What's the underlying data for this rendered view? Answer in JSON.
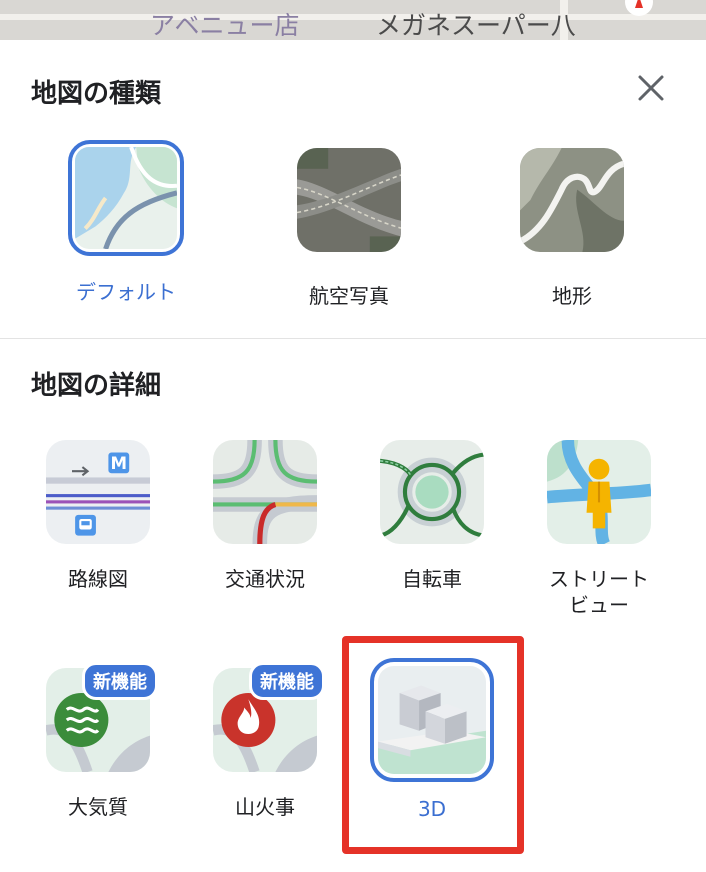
{
  "map": {
    "label_1": "アベニュー店",
    "label_2": "メガネスーパー八"
  },
  "map_types": {
    "title": "地図の種類",
    "close_icon": "close-icon",
    "items": [
      {
        "label": "デフォルト",
        "selected": true
      },
      {
        "label": "航空写真",
        "selected": false
      },
      {
        "label": "地形",
        "selected": false
      }
    ]
  },
  "map_details": {
    "title": "地図の詳細",
    "new_badge": "新機能",
    "items": [
      {
        "label": "路線図",
        "icon": "transit-map-icon"
      },
      {
        "label": "交通状況",
        "icon": "traffic-icon"
      },
      {
        "label": "自転車",
        "icon": "bicycle-map-icon"
      },
      {
        "label": "ストリート\nビュー",
        "label_line1": "ストリート",
        "label_line2": "ビュー",
        "icon": "street-view-icon"
      },
      {
        "label": "大気質",
        "icon": "air-quality-icon",
        "new": true
      },
      {
        "label": "山火事",
        "icon": "wildfire-icon",
        "new": true
      },
      {
        "label": "3D",
        "icon": "3d-buildings-icon",
        "selected": true
      }
    ]
  },
  "colors": {
    "accent": "#3e74d6",
    "highlight": "#e53228"
  }
}
